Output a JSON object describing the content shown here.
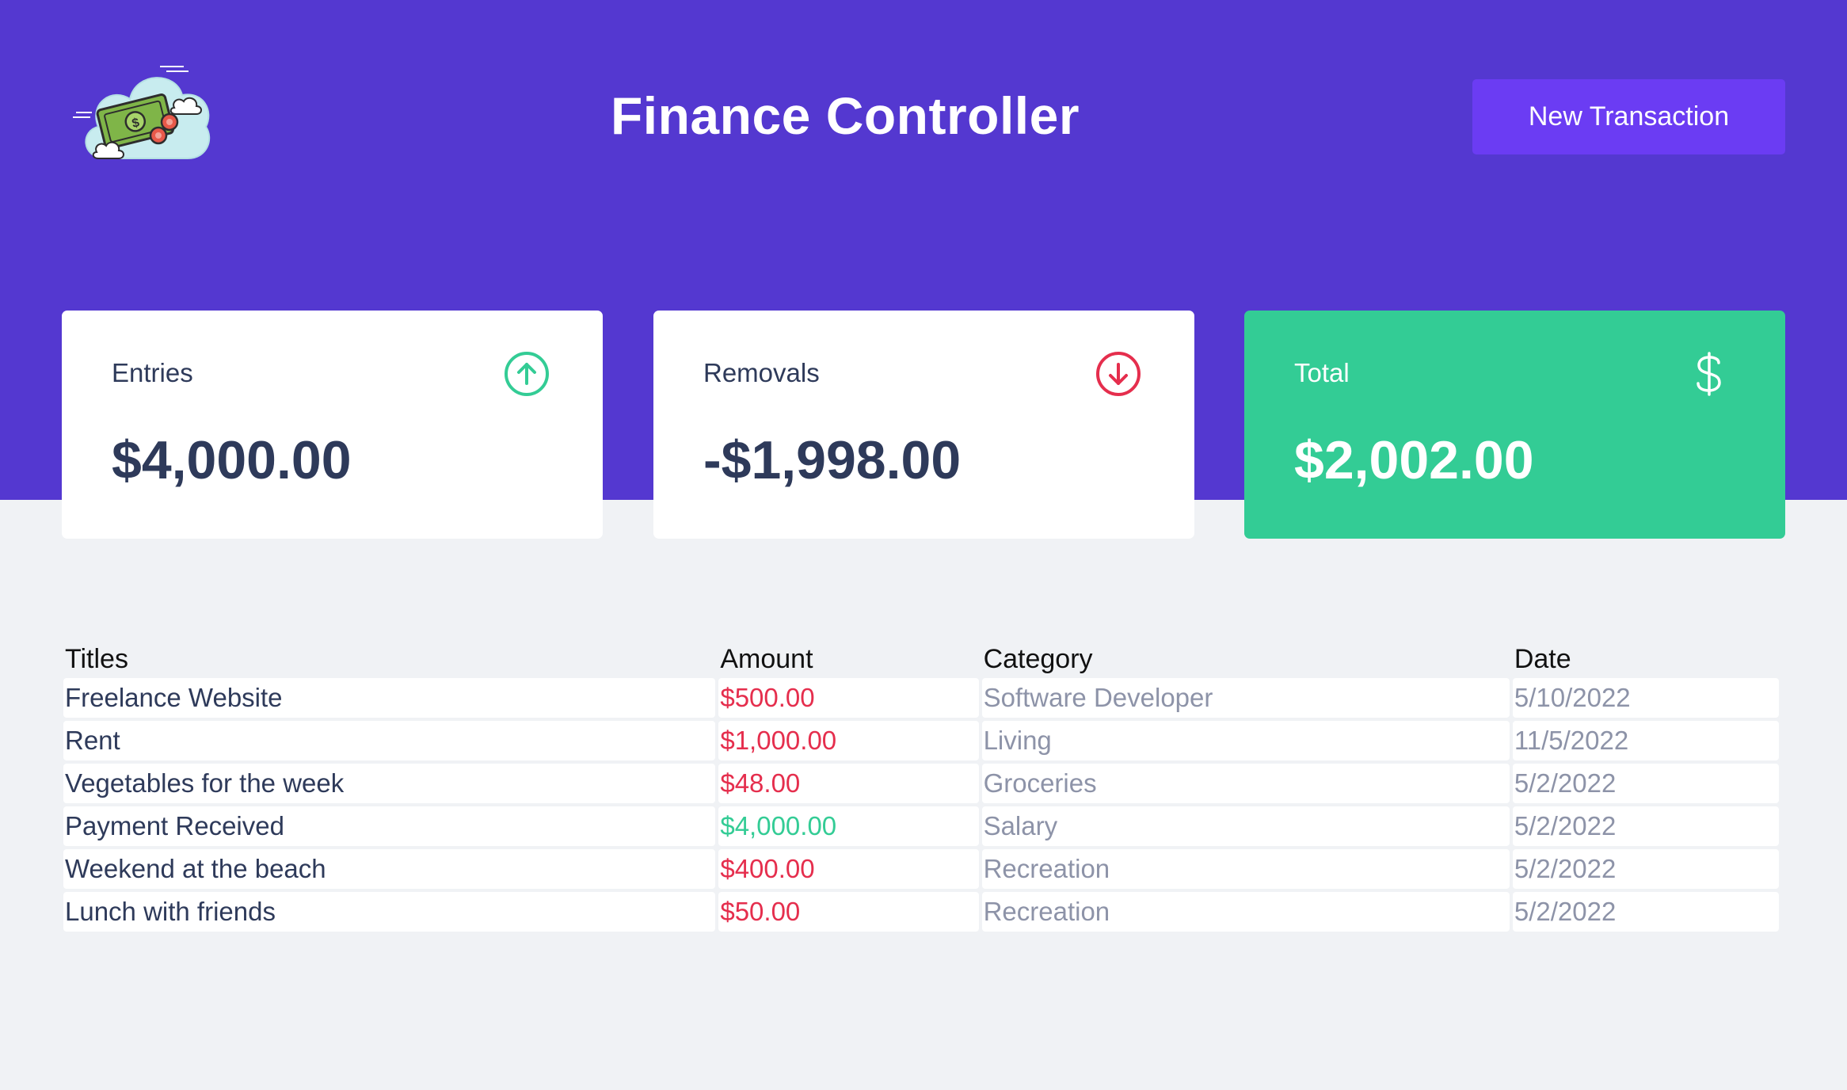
{
  "header": {
    "title": "Finance Controller",
    "new_transaction_label": "New Transaction",
    "logo_icon": "money-cloud-logo-icon"
  },
  "summary": {
    "entries": {
      "label": "Entries",
      "value": "$4,000.00",
      "icon": "arrow-circle-up-icon"
    },
    "removals": {
      "label": "Removals",
      "value": "-$1,998.00",
      "icon": "arrow-circle-down-icon"
    },
    "total": {
      "label": "Total",
      "value": "$2,002.00",
      "icon": "dollar-sign-icon"
    }
  },
  "table": {
    "headers": [
      "Titles",
      "Amount",
      "Category",
      "Date"
    ],
    "rows": [
      {
        "title": "Freelance Website",
        "amount": "$500.00",
        "type": "out",
        "category": "Software Developer",
        "date": "5/10/2022"
      },
      {
        "title": "Rent",
        "amount": "$1,000.00",
        "type": "out",
        "category": "Living",
        "date": "11/5/2022"
      },
      {
        "title": "Vegetables for the week",
        "amount": "$48.00",
        "type": "out",
        "category": "Groceries",
        "date": "5/2/2022"
      },
      {
        "title": "Payment Received",
        "amount": "$4,000.00",
        "type": "in",
        "category": "Salary",
        "date": "5/2/2022"
      },
      {
        "title": "Weekend at the beach",
        "amount": "$400.00",
        "type": "out",
        "category": "Recreation",
        "date": "5/2/2022"
      },
      {
        "title": "Lunch with friends",
        "amount": "$50.00",
        "type": "out",
        "category": "Recreation",
        "date": "5/2/2022"
      }
    ]
  },
  "colors": {
    "header_bg": "#5438d0",
    "button_bg": "#6b3cf3",
    "green": "#33cc95",
    "red": "#e52e4d",
    "text_dark": "#2e3a5a",
    "text_muted": "#8d93a8",
    "page_bg": "#f0f2f5"
  }
}
